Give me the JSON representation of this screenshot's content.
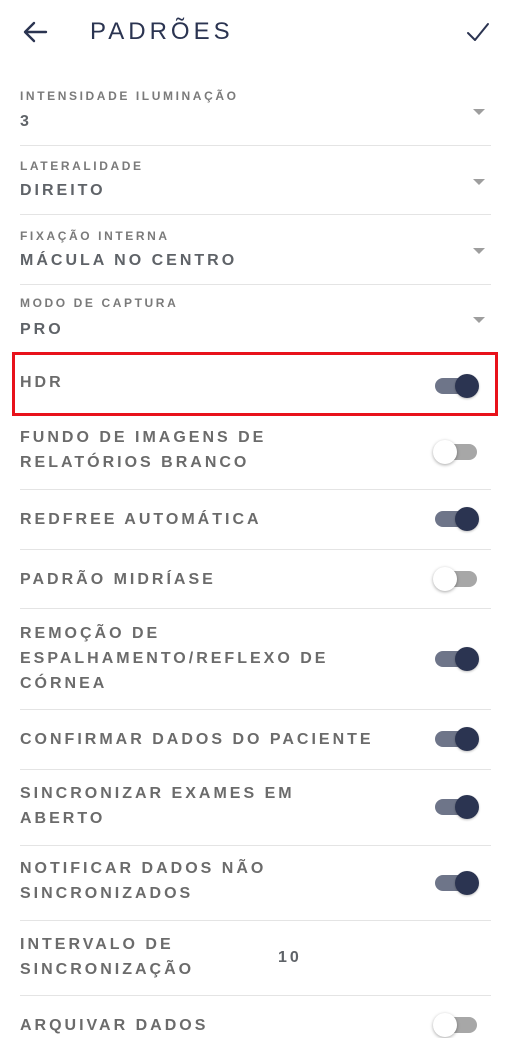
{
  "header": {
    "title": "PADRÕES"
  },
  "selects": [
    {
      "label": "INTENSIDADE ILUMINAÇÃO",
      "value": "3"
    },
    {
      "label": "LATERALIDADE",
      "value": "DIREITO"
    },
    {
      "label": "FIXAÇÃO INTERNA",
      "value": "MÁCULA NO CENTRO"
    },
    {
      "label": "MODO DE CAPTURA",
      "value": "PRO"
    }
  ],
  "toggles": [
    {
      "line1": "HDR",
      "line2": "",
      "line3": "",
      "on": true
    },
    {
      "line1": "FUNDO DE IMAGENS DE",
      "line2": "RELATÓRIOS BRANCO",
      "line3": "",
      "on": false
    },
    {
      "line1": "REDFREE AUTOMÁTICA",
      "line2": "",
      "line3": "",
      "on": true
    },
    {
      "line1": "PADRÃO MIDRÍASE",
      "line2": "",
      "line3": "",
      "on": false
    },
    {
      "line1": "REMOÇÃO DE",
      "line2": "ESPALHAMENTO/REFLEXO DE",
      "line3": "CÓRNEA",
      "on": true
    },
    {
      "line1": "CONFIRMAR DADOS DO PACIENTE",
      "line2": "",
      "line3": "",
      "on": true
    },
    {
      "line1": "SINCRONIZAR EXAMES EM",
      "line2": "ABERTO",
      "line3": "",
      "on": true
    },
    {
      "line1": "NOTIFICAR DADOS NÃO",
      "line2": "SINCRONIZADOS",
      "line3": "",
      "on": true
    }
  ],
  "interval": {
    "line1": "INTERVALO DE",
    "line2": "SINCRONIZAÇÃO",
    "value": "10"
  },
  "archive": {
    "label": "ARQUIVAR DADOS",
    "on": false
  },
  "colors": {
    "accent": "#2b3451",
    "highlight": "#e8121b"
  }
}
